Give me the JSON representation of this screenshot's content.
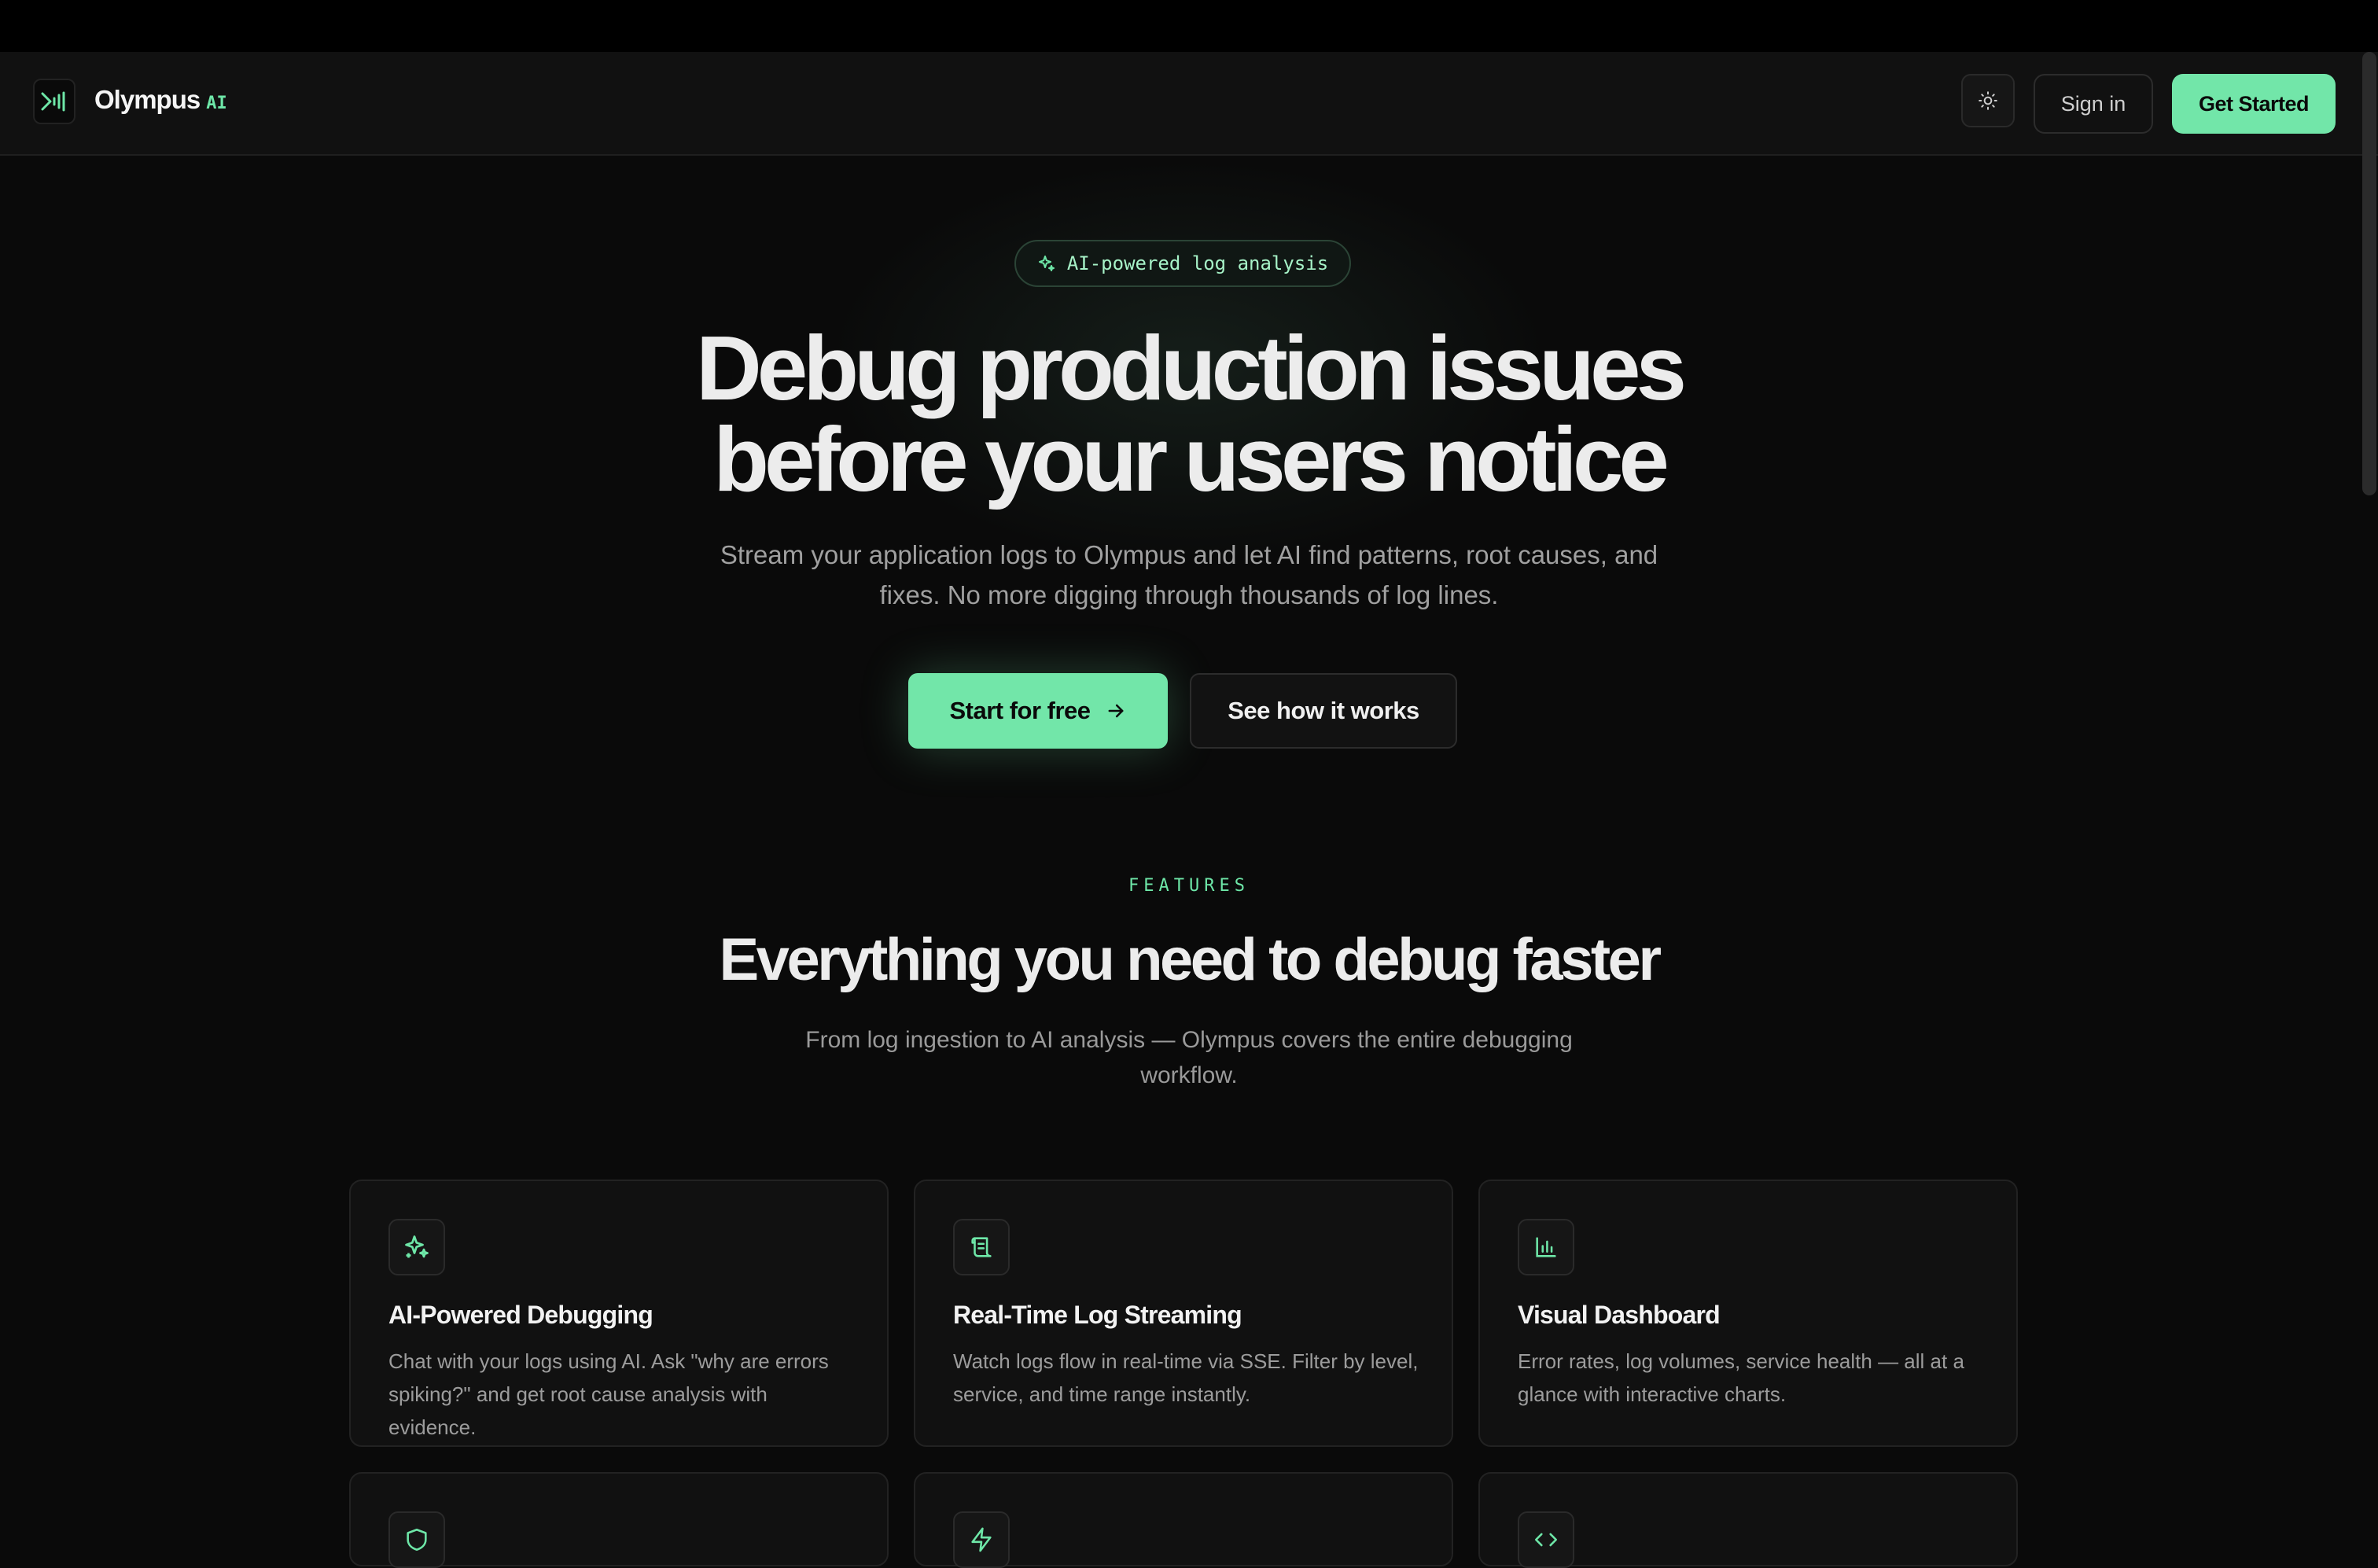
{
  "nav": {
    "brand_name": "Olympus",
    "brand_suffix": "AI",
    "theme_icon": "sun-icon",
    "sign_in_label": "Sign in",
    "get_started_label": "Get Started"
  },
  "hero": {
    "badge_text": "AI-powered log analysis",
    "title_line1": "Debug production issues",
    "title_line2": "before your users notice",
    "subtitle": "Stream your application logs to Olympus and let AI find patterns, root causes, and fixes. No more digging through thousands of log lines.",
    "cta_primary": "Start for free",
    "cta_secondary": "See how it works"
  },
  "features": {
    "kicker": "FEATURES",
    "title": "Everything you need to debug faster",
    "subtitle": "From log ingestion to AI analysis — Olympus covers the entire debugging workflow.",
    "cards": [
      {
        "icon": "sparkles-icon",
        "title": "AI-Powered Debugging",
        "description": "Chat with your logs using AI. Ask \"why are errors spiking?\" and get root cause analysis with evidence."
      },
      {
        "icon": "scroll-icon",
        "title": "Real-Time Log Streaming",
        "description": "Watch logs flow in real-time via SSE. Filter by level, service, and time range instantly."
      },
      {
        "icon": "bar-chart-icon",
        "title": "Visual Dashboard",
        "description": "Error rates, log volumes, service health — all at a glance with interactive charts."
      },
      {
        "icon": "shield-icon"
      },
      {
        "icon": "zap-icon"
      },
      {
        "icon": "code-icon"
      }
    ]
  },
  "colors": {
    "accent": "#72e6a9",
    "background": "#0a0a0a",
    "surface": "#111111",
    "border": "#222222"
  }
}
